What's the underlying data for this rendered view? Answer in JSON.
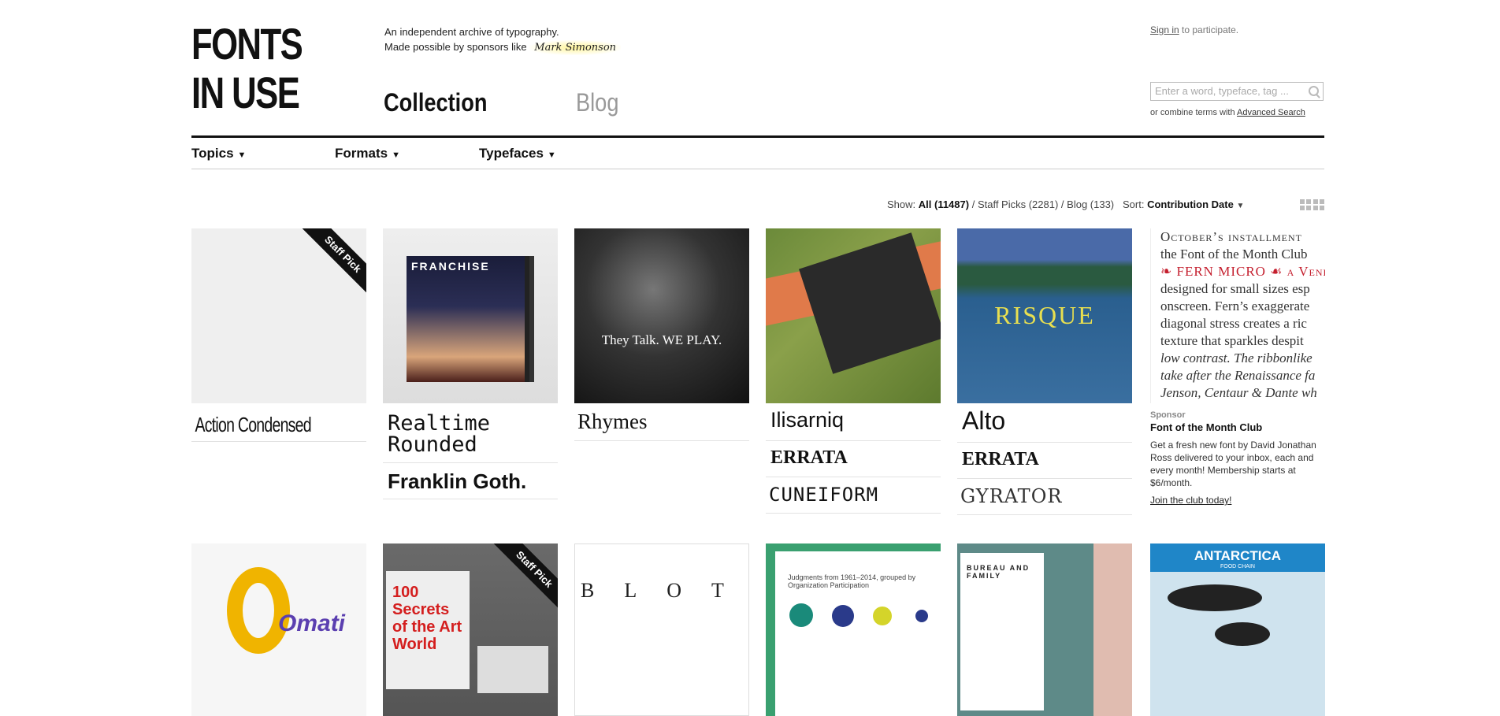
{
  "header": {
    "logo_line1": "FONTS",
    "logo_line2": "IN USE",
    "tagline_line1": "An independent archive of typography.",
    "tagline_line2": "Made possible by sponsors like",
    "sponsor_logo": "Mark Simonson",
    "tabs": [
      {
        "label": "Collection"
      },
      {
        "label": "Blog"
      }
    ],
    "signin_link": "Sign in",
    "signin_rest": " to participate.",
    "search_placeholder": "Enter a word, typeface, tag ...",
    "combine_text": "or combine terms with ",
    "advanced_search": "Advanced Search"
  },
  "subnav": [
    {
      "label": "Topics"
    },
    {
      "label": "Formats"
    },
    {
      "label": "Typefaces"
    }
  ],
  "controls": {
    "show_label": "Show:",
    "all": "All (11487)",
    "staff_picks": "Staff Picks (2281)",
    "blog": "Blog (133)",
    "sort_label": "Sort:",
    "sort_value": "Contribution Date"
  },
  "row1": [
    {
      "fonts": [
        "Action Condensed"
      ],
      "staff_pick": "Staff Pick"
    },
    {
      "fonts": [
        "Realtime Rounded",
        "Franklin Goth."
      ],
      "image_text": "FRANCHISE"
    },
    {
      "fonts": [
        "Rhymes"
      ],
      "image_text": "They Talk. WE PLAY."
    },
    {
      "fonts": [
        "Ilisarniq",
        "ERRATA",
        "CUNEIFORM"
      ]
    },
    {
      "fonts": [
        "Alto",
        "ERRATA",
        "GYRATOR"
      ],
      "image_text": "RISQUE"
    }
  ],
  "ad": {
    "text_lines": [
      "October’s installment",
      "the Font of the Month Club",
      "❧ FERN MICRO ☙ a Venetian",
      "designed for small sizes esp",
      "onscreen. Fern’s exaggerate",
      "diagonal stress creates a ric",
      "texture that sparkles despit",
      "low contrast. The ribbonlike",
      "take after the Renaissance fa",
      "Jenson, Centaur & Dante wh"
    ],
    "sponsor_label": "Sponsor",
    "title": "Font of the Month Club",
    "body": "Get a fresh new font by David Jonathan Ross delivered to your inbox, each and every month! Membership starts at $6/month.",
    "link": "Join the club today!"
  },
  "row2": [
    {
      "image_text": "Omati"
    },
    {
      "image_text": "100 Secrets of the Art World",
      "staff_pick": "Staff Pick"
    },
    {
      "image_text": "BLOTTE"
    },
    {
      "image_text": "Judgments from 1961–2014, grouped by Organization Participation"
    },
    {
      "image_text": "BUREAU AND FAMILY"
    },
    {
      "image_text": "ANTARCTICA",
      "image_sub": "FOOD CHAIN"
    }
  ],
  "colors": {
    "accent": "#111111",
    "staff_pick_bg": "#111111",
    "fern_red": "#c41e2d"
  }
}
